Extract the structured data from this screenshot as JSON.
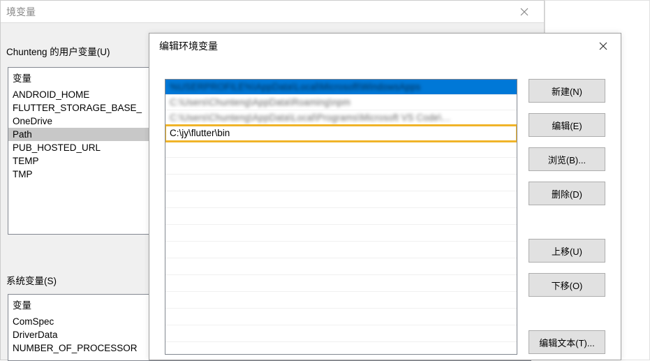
{
  "backDialog": {
    "title": "境变量",
    "closeIcon": "close",
    "userVarsLabel": "Chunteng 的用户变量(U)",
    "sysVarsLabel": "系统变量(S)",
    "varHeader": "变量",
    "userVars": [
      "ANDROID_HOME",
      "FLUTTER_STORAGE_BASE_",
      "OneDrive",
      "Path",
      "PUB_HOSTED_URL",
      "TEMP",
      "TMP"
    ],
    "userSelectedIndex": 3,
    "sysVars": [
      "ComSpec",
      "DriverData",
      "NUMBER_OF_PROCESSOR"
    ]
  },
  "frontDialog": {
    "title": "编辑环境变量",
    "closeIcon": "close",
    "pathItems": [
      {
        "text": "%USERPROFILE%\\AppData\\Local\\Microsoft\\WindowsApps",
        "blurred": true,
        "selected": true
      },
      {
        "text": "C:\\Users\\Chunteng\\AppData\\Roaming\\npm",
        "blurred": true
      },
      {
        "text": "C:\\Users\\Chunteng\\AppData\\Local\\Programs\\Microsoft VS Code\\…",
        "blurred": true
      },
      {
        "text": "C:\\jy\\flutter\\bin",
        "highlighted": true
      }
    ],
    "buttons": {
      "new": "新建(N)",
      "edit": "编辑(E)",
      "browse": "浏览(B)...",
      "delete": "删除(D)",
      "moveUp": "上移(U)",
      "moveDown": "下移(O)",
      "editText": "编辑文本(T)..."
    }
  }
}
